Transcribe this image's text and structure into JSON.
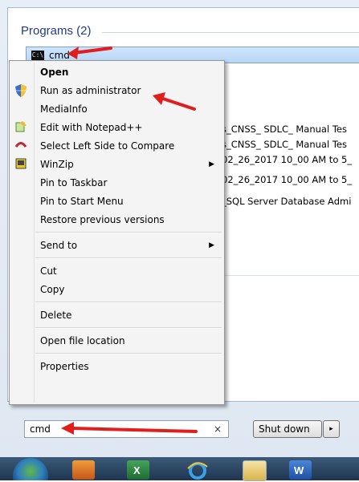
{
  "start_menu": {
    "programs_header": "Programs (2)",
    "selected_program": {
      "icon": "cmd-icon",
      "label": "cmd"
    },
    "background_files": [
      "s_CNSS_ SDLC_ Manual Tes",
      "s_CNSS_ SDLC_ Manual Tes",
      "02_26_2017 10_00 AM to 5_",
      "02_26_2017 10_00 AM to 5_",
      "_SQL Server Database Admi"
    ]
  },
  "context_menu": {
    "items": [
      {
        "label": "Open",
        "bold": true
      },
      {
        "label": "Run as administrator",
        "icon": "uac-shield-icon"
      },
      {
        "label": "MediaInfo"
      },
      {
        "label": "Edit with Notepad++",
        "icon": "notepad-plus-icon"
      },
      {
        "label": "Select Left Side to Compare",
        "icon": "compare-icon"
      },
      {
        "label": "WinZip",
        "icon": "winzip-icon",
        "submenu": true
      },
      {
        "label": "Pin to Taskbar"
      },
      {
        "label": "Pin to Start Menu"
      },
      {
        "label": "Restore previous versions"
      },
      {
        "label": "Send to",
        "submenu": true
      },
      {
        "label": "Cut"
      },
      {
        "label": "Copy"
      },
      {
        "label": "Delete"
      },
      {
        "label": "Open file location"
      },
      {
        "label": "Properties"
      }
    ]
  },
  "search": {
    "value": "cmd",
    "clear_glyph": "×"
  },
  "shutdown": {
    "label": "Shut down",
    "arrow": "▸"
  },
  "taskbar": {
    "items": [
      "start-orb",
      "app-icon",
      "excel-icon",
      "ie-icon",
      "explorer-icon",
      "word-icon"
    ]
  },
  "colors": {
    "annotation_arrow": "#e11d1d",
    "highlight": "#cfe4fb"
  }
}
